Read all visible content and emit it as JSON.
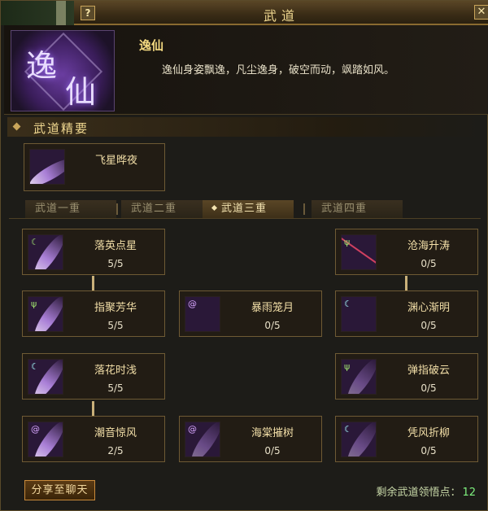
{
  "window": {
    "title": "武道",
    "help_label": "?",
    "close_label": "✕"
  },
  "header": {
    "emblem_char_1": "逸",
    "emblem_char_2": "仙",
    "name": "逸仙",
    "description": "逸仙身姿飘逸，凡尘逸身，破空而动，飒踏如风。"
  },
  "section": {
    "title": "武道精要"
  },
  "core_skill": {
    "name": "飞星晔夜"
  },
  "tabs": [
    {
      "label": "武道一重",
      "active": false
    },
    {
      "label": "武道二重",
      "active": false
    },
    {
      "label": "武道三重",
      "active": true
    },
    {
      "label": "武道四重",
      "active": false
    }
  ],
  "skills": [
    {
      "name": "落英点星",
      "level": "5/5"
    },
    {
      "name": "沧海升涛",
      "level": "0/5"
    },
    {
      "name": "指聚芳华",
      "level": "5/5"
    },
    {
      "name": "暴雨笼月",
      "level": "0/5"
    },
    {
      "name": "渊心渐明",
      "level": "0/5"
    },
    {
      "name": "落花时浅",
      "level": "5/5"
    },
    {
      "name": "弹指破云",
      "level": "0/5"
    },
    {
      "name": "潮音惊风",
      "level": "2/5"
    },
    {
      "name": "海棠摧树",
      "level": "0/5"
    },
    {
      "name": "凭风折柳",
      "level": "0/5"
    }
  ],
  "footer": {
    "share_label": "分享至聊天",
    "points_label": "剩余武道领悟点：",
    "points_value": "12"
  },
  "colors": {
    "accent_gold": "#f0d890",
    "card_border": "#6e5a34",
    "points_green": "#7ef07e"
  }
}
